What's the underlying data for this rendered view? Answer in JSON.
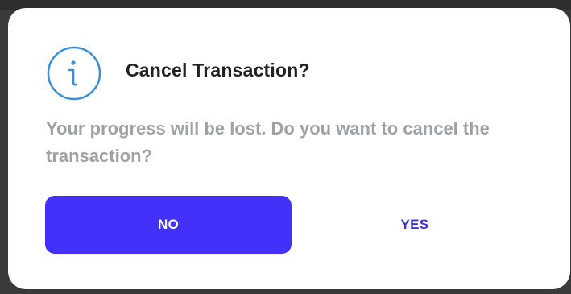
{
  "dialog": {
    "icon": "info-icon",
    "title": "Cancel Transaction?",
    "message": "Your progress will be lost. Do you want to cancel the transaction?",
    "buttons": {
      "no_label": "NO",
      "yes_label": "YES"
    }
  },
  "colors": {
    "primary": "#4231f8",
    "title_text": "#1f2125",
    "message_text": "#9ea2a7",
    "icon_stroke": "#3b8fd6"
  }
}
